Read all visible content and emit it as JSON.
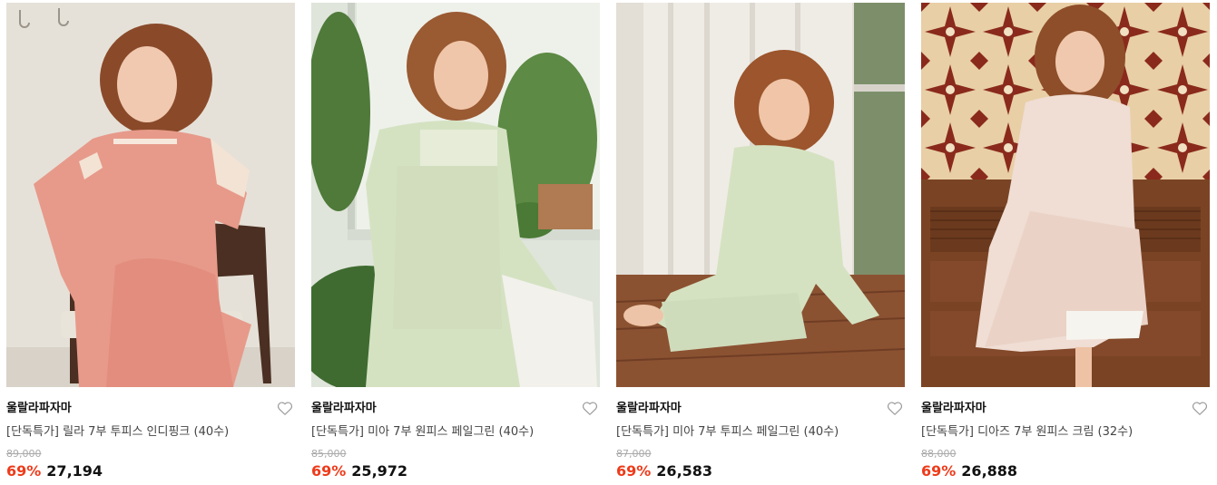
{
  "colors": {
    "discount": "#ee3b1b",
    "text": "#111111",
    "muted": "#aaaaaa"
  },
  "products": [
    {
      "image_icon": "product-photo",
      "brand": "울랄라파자마",
      "title": "[단독특가] 릴라 7부 투피스 인디핑크 (40수)",
      "original_price": "89,000",
      "discount": "69%",
      "sale_price": "27,194",
      "wish_icon": "heart-outline-icon"
    },
    {
      "image_icon": "product-photo",
      "brand": "울랄라파자마",
      "title": "[단독특가] 미아 7부 원피스 페일그린 (40수)",
      "original_price": "85,000",
      "discount": "69%",
      "sale_price": "25,972",
      "wish_icon": "heart-outline-icon"
    },
    {
      "image_icon": "product-photo",
      "brand": "울랄라파자마",
      "title": "[단독특가] 미아 7부 투피스 페일그린 (40수)",
      "original_price": "87,000",
      "discount": "69%",
      "sale_price": "26,583",
      "wish_icon": "heart-outline-icon"
    },
    {
      "image_icon": "product-photo",
      "brand": "울랄라파자마",
      "title": "[단독특가] 디아즈 7부 원피스 크림 (32수)",
      "original_price": "88,000",
      "discount": "69%",
      "sale_price": "26,888",
      "wish_icon": "heart-outline-icon"
    }
  ]
}
